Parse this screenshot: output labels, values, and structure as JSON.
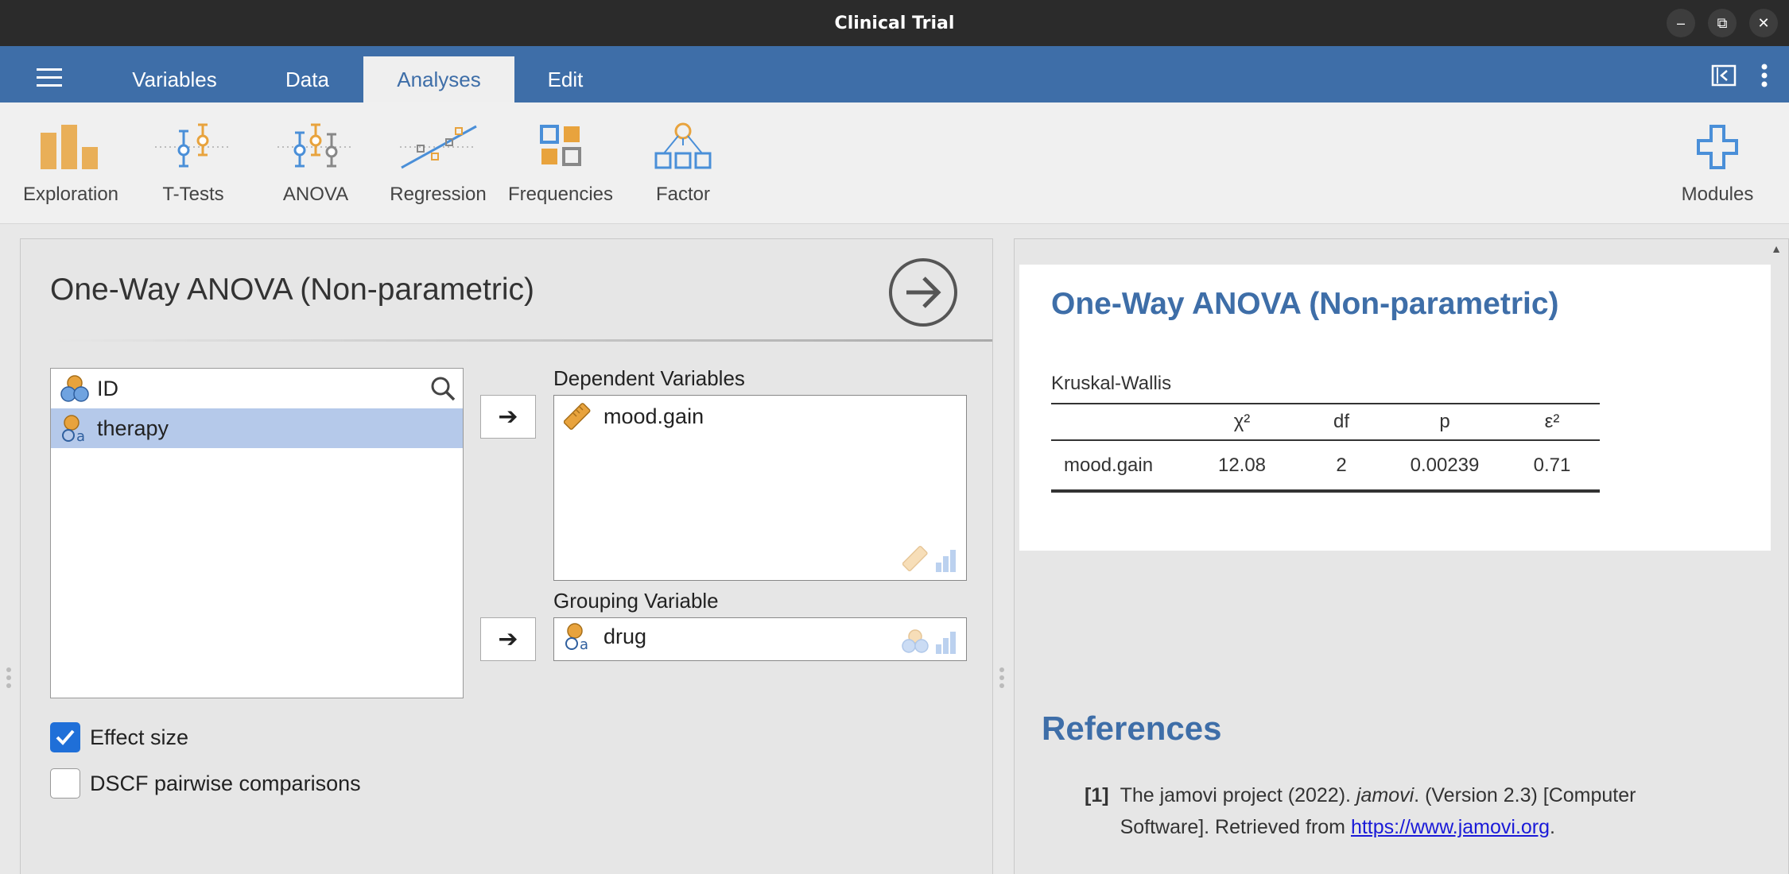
{
  "window": {
    "title": "Clinical Trial",
    "controls": [
      "minimize",
      "restore",
      "close"
    ]
  },
  "menu": {
    "tabs": [
      {
        "label": "Variables",
        "active": false
      },
      {
        "label": "Data",
        "active": false
      },
      {
        "label": "Analyses",
        "active": true
      },
      {
        "label": "Edit",
        "active": false
      }
    ]
  },
  "ribbon": {
    "items": [
      {
        "label": "Exploration",
        "icon": "exploration-icon"
      },
      {
        "label": "T-Tests",
        "icon": "t-tests-icon"
      },
      {
        "label": "ANOVA",
        "icon": "anova-icon"
      },
      {
        "label": "Regression",
        "icon": "regression-icon"
      },
      {
        "label": "Frequencies",
        "icon": "frequencies-icon"
      },
      {
        "label": "Factor",
        "icon": "factor-icon"
      }
    ],
    "modules_label": "Modules"
  },
  "options": {
    "title": "One-Way ANOVA (Non-parametric)",
    "variables": [
      {
        "name": "ID",
        "type": "id",
        "selected": false
      },
      {
        "name": "therapy",
        "type": "nominal",
        "selected": true
      }
    ],
    "dependent_label": "Dependent Variables",
    "dependent_vars": [
      {
        "name": "mood.gain",
        "type": "continuous"
      }
    ],
    "grouping_label": "Grouping Variable",
    "grouping_var": {
      "name": "drug",
      "type": "nominal"
    },
    "effect_size": {
      "label": "Effect size",
      "checked": true
    },
    "dscf": {
      "label": "DSCF pairwise comparisons",
      "checked": false
    }
  },
  "results": {
    "title": "One-Way ANOVA (Non-parametric)",
    "table_title": "Kruskal-Wallis",
    "columns": [
      "",
      "χ²",
      "df",
      "p",
      "ε²"
    ],
    "rows": [
      [
        "mood.gain",
        "12.08",
        "2",
        "0.00239",
        "0.71"
      ]
    ],
    "references_title": "References",
    "reference": {
      "num": "[1]",
      "text_before": "The jamovi project (2022). ",
      "italic": "jamovi",
      "text_after": ". (Version 2.3) [Computer Software]. Retrieved from ",
      "link": "https://www.jamovi.org",
      "end": "."
    }
  },
  "colors": {
    "brand": "#3e6ea8",
    "accent_orange": "#e8a33d",
    "accent_blue": "#4a8fd8",
    "checkbox": "#1f6fd8"
  }
}
